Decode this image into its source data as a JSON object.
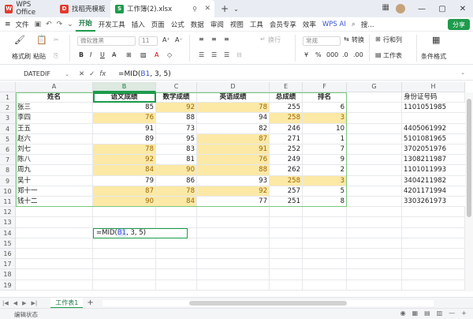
{
  "titlebar": {
    "tabs": [
      {
        "label": "WPS Office",
        "icon": "wps-icon",
        "icon_glyph": "W"
      },
      {
        "label": "找稻壳模板",
        "icon": "pdf-icon",
        "icon_glyph": "D"
      },
      {
        "label": "工作簿(2).xlsx",
        "icon": "sheet-icon",
        "icon_glyph": "S"
      }
    ],
    "plus": "+"
  },
  "menubar": {
    "file_label": "文件",
    "items": [
      "开始",
      "开发工具",
      "插入",
      "页面",
      "公式",
      "数据",
      "审阅",
      "视图",
      "工具",
      "会员专享",
      "效率"
    ],
    "active_index": 0,
    "wps_ai": "WPS AI",
    "search_label": "搜...",
    "share_label": "分享"
  },
  "ribbon": {
    "format_painter": "格式刷",
    "paste": "粘贴",
    "font_name": "微软雅黑",
    "font_size": "11",
    "wrap_label": "换行",
    "number_format": "常规",
    "convert_label": "转换",
    "rows_cols": "行和列",
    "worksheet": "工作表",
    "cond_format": "条件格式"
  },
  "formula_bar": {
    "name_box": "DATEDIF",
    "formula_prefix": "=MID(",
    "formula_ref": "B1",
    "formula_suffix": ", 3, 5)"
  },
  "grid": {
    "columns": [
      "A",
      "B",
      "C",
      "D",
      "E",
      "F",
      "G",
      "H"
    ],
    "rows": [
      "1",
      "2",
      "3",
      "4",
      "5",
      "6",
      "7",
      "8",
      "9",
      "10",
      "11",
      "12",
      "13",
      "14",
      "15",
      "16",
      "17",
      "18",
      "19"
    ],
    "headers": [
      "姓名",
      "语文成绩",
      "数学成绩",
      "英语成绩",
      "总成绩",
      "排名",
      "",
      "身份证号码"
    ],
    "data": [
      {
        "name": "张三",
        "chinese": "85",
        "math": "92",
        "english": "78",
        "total": "255",
        "rank": "6",
        "id": "1101051985"
      },
      {
        "name": "李四",
        "chinese": "76",
        "math": "88",
        "english": "94",
        "total": "258",
        "rank": "3",
        "id": ""
      },
      {
        "name": "王五",
        "chinese": "91",
        "math": "73",
        "english": "82",
        "total": "246",
        "rank": "10",
        "id": "4405061992"
      },
      {
        "name": "赵六",
        "chinese": "89",
        "math": "95",
        "english": "87",
        "total": "271",
        "rank": "1",
        "id": "5101081965"
      },
      {
        "name": "刘七",
        "chinese": "78",
        "math": "83",
        "english": "91",
        "total": "252",
        "rank": "7",
        "id": "3702051976"
      },
      {
        "name": "陈八",
        "chinese": "92",
        "math": "81",
        "english": "76",
        "total": "249",
        "rank": "9",
        "id": "1308211987"
      },
      {
        "name": "周九",
        "chinese": "84",
        "math": "90",
        "english": "88",
        "total": "262",
        "rank": "2",
        "id": "1101011993"
      },
      {
        "name": "吴十",
        "chinese": "79",
        "math": "86",
        "english": "93",
        "total": "258",
        "rank": "3",
        "id": "3404211982"
      },
      {
        "name": "郑十一",
        "chinese": "87",
        "math": "78",
        "english": "92",
        "total": "257",
        "rank": "5",
        "id": "4201171994"
      },
      {
        "name": "钱十二",
        "chinese": "90",
        "math": "84",
        "english": "77",
        "total": "251",
        "rank": "8",
        "id": "3303261973"
      }
    ],
    "editing_cell": {
      "prefix": "=MID(",
      "ref": "B1",
      "suffix": ", 3, 5)"
    }
  },
  "sheet_tabs": [
    "工作表1"
  ],
  "status": {
    "mode": "编辑状态"
  },
  "colors": {
    "accent": "#1e9b4c",
    "highlight_fill": "#fce9a6",
    "highlight_text": "#9c6500"
  }
}
